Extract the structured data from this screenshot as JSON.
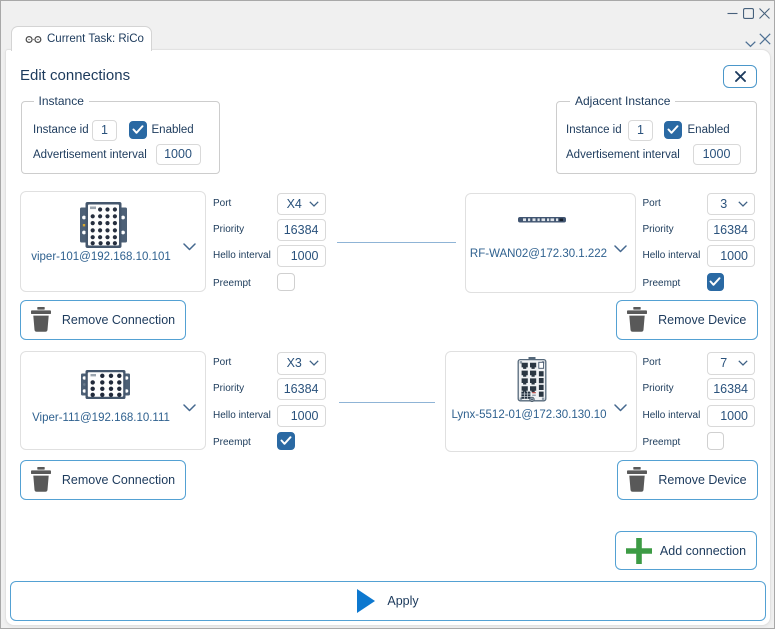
{
  "window": {
    "titlebar": {
      "minimize": "minimize",
      "maximize": "maximize",
      "close": "close"
    }
  },
  "tab": {
    "label": "Current Task: RiCo"
  },
  "dialog": {
    "title": "Edit connections"
  },
  "param_labels": {
    "port": "Port",
    "priority": "Priority",
    "hello": "Hello interval",
    "preempt": "Preempt"
  },
  "instance_group": {
    "legend": "Instance",
    "instance_id_label": "Instance id",
    "instance_id_value": "1",
    "enabled_label": "Enabled",
    "enabled_checked": true,
    "adv_interval_label": "Advertisement interval",
    "adv_interval_value": "1000"
  },
  "adjacent_group": {
    "legend": "Adjacent Instance",
    "instance_id_label": "Instance id",
    "instance_id_value": "1",
    "enabled_label": "Enabled",
    "enabled_checked": true,
    "adv_interval_label": "Advertisement interval",
    "adv_interval_value": "1000"
  },
  "connections": [
    {
      "left": {
        "device_name": "viper-101@192.168.10.101",
        "device_image": "viper-101-m12-switch",
        "port_value": "X4",
        "priority_value": "16384",
        "hello_value": "1000",
        "preempt_checked": false,
        "remove_label": "Remove Connection"
      },
      "right": {
        "device_name": "RF-WAN02@172.30.1.222",
        "device_image": "rack-mount-router",
        "port_value": "3",
        "priority_value": "16384",
        "hello_value": "1000",
        "preempt_checked": true,
        "remove_label": "Remove Device"
      }
    },
    {
      "left": {
        "device_name": "Viper-111@192.168.10.111",
        "device_image": "viper-111-m12-switch",
        "port_value": "X3",
        "priority_value": "16384",
        "hello_value": "1000",
        "preempt_checked": true,
        "remove_label": "Remove Connection"
      },
      "right": {
        "device_name": "Lynx-5512-01@172.30.130.10",
        "device_image": "lynx-din-rail-switch",
        "port_value": "7",
        "priority_value": "16384",
        "hello_value": "1000",
        "preempt_checked": false,
        "remove_label": "Remove Device"
      }
    }
  ],
  "actions": {
    "add_connection": "Add connection",
    "apply": "Apply"
  },
  "colors": {
    "accent_blue_border": "#54a1d3",
    "checkbox_blue": "#2a69a3",
    "apply_triangle_blue": "#0d78cf",
    "add_plus_green": "#3d9b45",
    "text_navy": "#1c3a5c",
    "device_name_blue": "#2f618f",
    "connection_line": "#8fb4d6"
  }
}
